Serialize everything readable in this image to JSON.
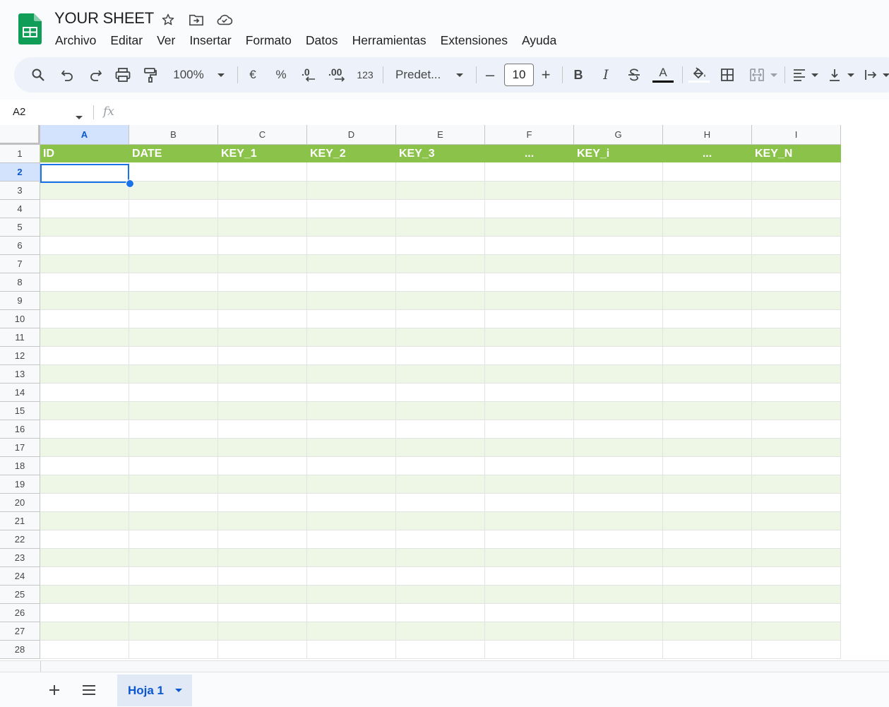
{
  "document": {
    "title": "YOUR SHEET"
  },
  "menu": [
    "Archivo",
    "Editar",
    "Ver",
    "Insertar",
    "Formato",
    "Datos",
    "Herramientas",
    "Extensiones",
    "Ayuda"
  ],
  "toolbar": {
    "zoom": "100%",
    "currency": "€",
    "percent": "%",
    "decrease_decimal": ".0",
    "increase_decimal": ".00",
    "number_format": "123",
    "font_name": "Predet...",
    "font_size": "10",
    "bold": "B",
    "italic": "I",
    "text_color": "A",
    "minus": "–",
    "plus": "+"
  },
  "formula_bar": {
    "name_box": "A2",
    "fx": "fx"
  },
  "grid": {
    "columns": [
      "A",
      "B",
      "C",
      "D",
      "E",
      "F",
      "G",
      "H",
      "I"
    ],
    "rows": [
      "1",
      "2",
      "3",
      "4",
      "5",
      "6",
      "7",
      "8",
      "9",
      "10",
      "11",
      "12",
      "13",
      "14",
      "15",
      "16",
      "17",
      "18",
      "19",
      "20",
      "21",
      "22",
      "23",
      "24",
      "25",
      "26",
      "27",
      "28"
    ],
    "header_row": [
      "ID",
      "DATE",
      "KEY_1",
      "KEY_2",
      "KEY_3",
      "...",
      "KEY_i",
      "...",
      "KEY_N"
    ],
    "active_cell": "A2"
  },
  "sheets": {
    "active": "Hoja 1"
  },
  "colors": {
    "header_green": "#8bc34a",
    "band_green": "#eef6e5",
    "selection_blue": "#1a73e8"
  }
}
